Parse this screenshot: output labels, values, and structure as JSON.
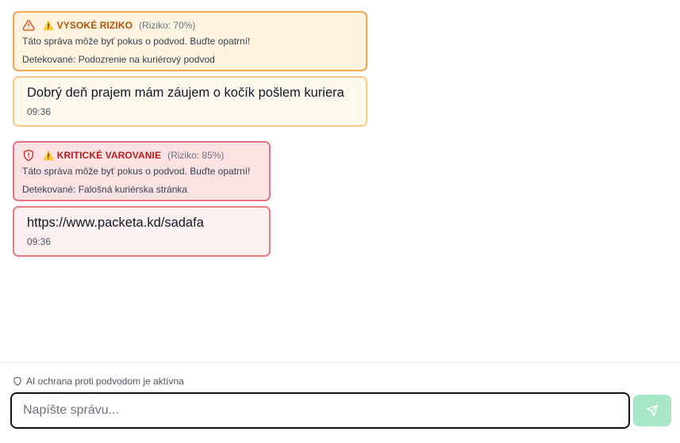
{
  "messages": [
    {
      "alert": {
        "icon": "warning-triangle-icon",
        "emoji": "⚠️",
        "title": "VYSOKÉ RIZIKO",
        "risk": "(Riziko: 70%)",
        "warning": "Táto správa môže byť pokus o podvod. Buďte opatrní!",
        "detected": "Detekované: Podozrenie na kuriérový podvod",
        "color": "#b45309"
      },
      "text": "Dobrý deň prajem mám záujem o kočík pošlem kuriera",
      "time": "09:36"
    },
    {
      "alert": {
        "icon": "shield-alert-icon",
        "emoji": "⚠️",
        "title": "KRITICKÉ VAROVANIE",
        "risk": "(Riziko: 85%)",
        "warning": "Táto správa môže byť pokus o podvod. Buďte opatrní!",
        "detected": "Detekované: Falošná kuriérska stránka",
        "color": "#b91c1c"
      },
      "text": "https://www.packeta.kd/sadafa",
      "time": "09:36"
    }
  ],
  "footer": {
    "status": "AI ochrana proti podvodom je aktívna",
    "status_icon": "shield-icon",
    "input_placeholder": "Napíšte správu...",
    "send_icon": "send-icon",
    "send_color": "#a7e6c6"
  }
}
